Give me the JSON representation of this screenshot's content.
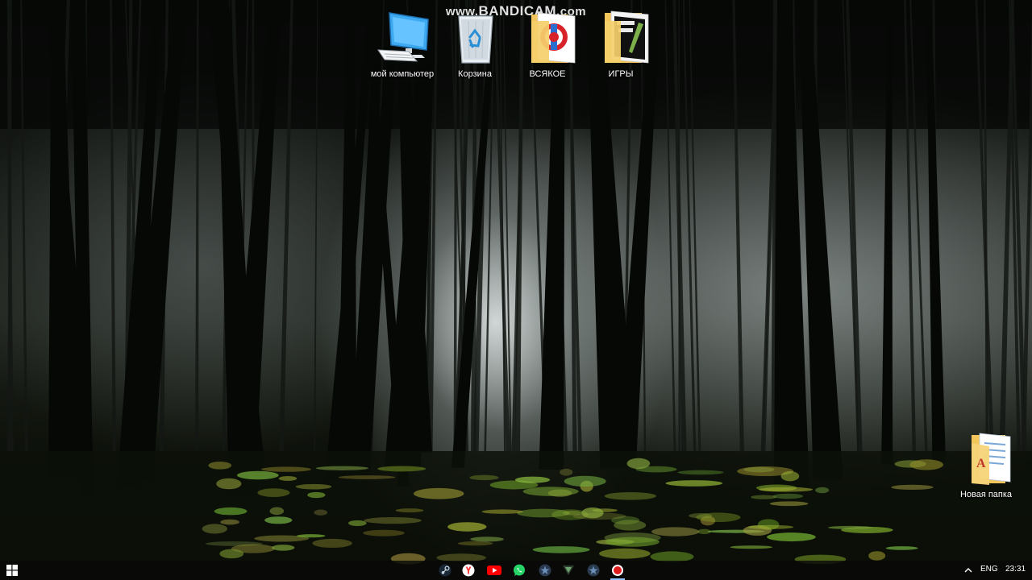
{
  "watermark": {
    "prefix": "www.",
    "brand": "BANDICAM",
    "suffix": ".com"
  },
  "desktop": {
    "icons": [
      {
        "label": "мой компьютер",
        "icon": "computer-icon"
      },
      {
        "label": "Корзина",
        "icon": "recycle-bin-icon"
      },
      {
        "label": "ВСЯКОЕ",
        "icon": "folder-icon"
      },
      {
        "label": "ИГРЫ",
        "icon": "folder-icon"
      },
      {
        "label": "Новая папка",
        "icon": "folder-icon"
      }
    ]
  },
  "taskbar": {
    "start_icon": "windows-logo-icon",
    "apps": [
      {
        "icon": "steam-icon",
        "color": "#c7d5e0"
      },
      {
        "icon": "yandex-browser-icon",
        "color": "#ff3333"
      },
      {
        "icon": "youtube-icon",
        "color": "#ff0000"
      },
      {
        "icon": "whatsapp-icon",
        "color": "#25d366"
      },
      {
        "icon": "rockstar-launcher-icon",
        "color": "#6b8fb8"
      },
      {
        "icon": "vortex-icon",
        "color": "#6fa36f"
      },
      {
        "icon": "rockstar-app-icon",
        "color": "#6b8fb8"
      },
      {
        "icon": "bandicam-record-icon",
        "color": "#e01b1b"
      }
    ],
    "tray_arrow_icon": "chevron-up-icon",
    "language": "ENG",
    "clock": "23:31"
  },
  "colors": {
    "accent": "#8fc3ff",
    "folder": "#f2c65a"
  }
}
